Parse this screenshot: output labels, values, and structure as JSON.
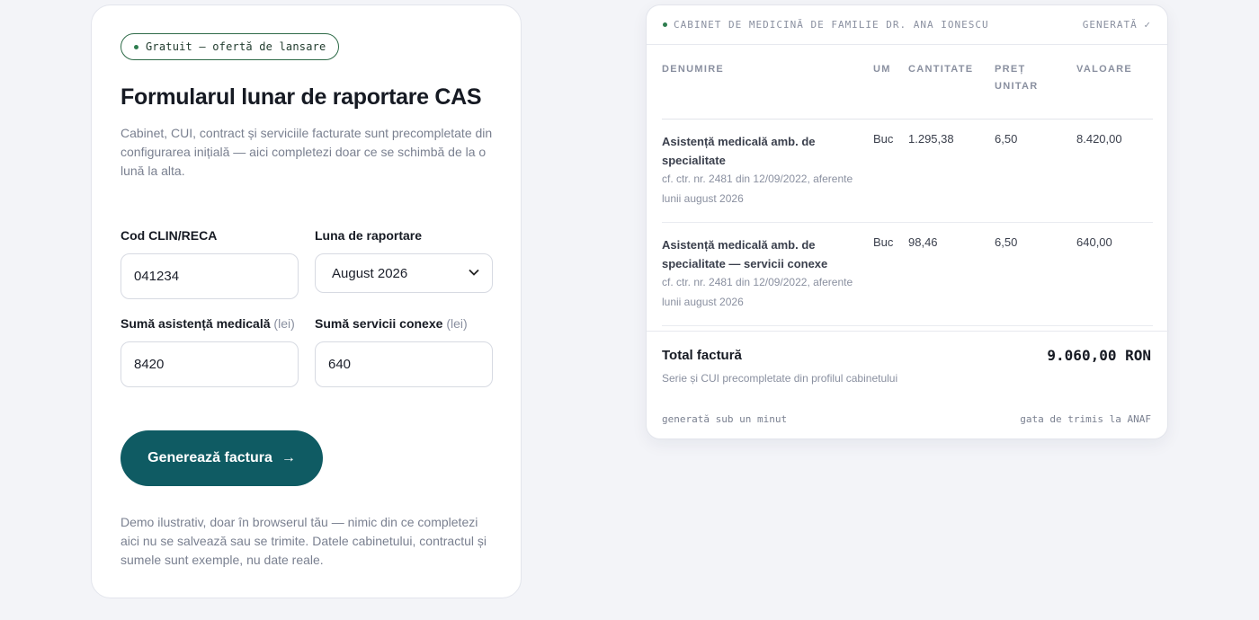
{
  "form": {
    "badge": "Gratuit — ofertă de lansare",
    "title": "Formularul lunar de raportare CAS",
    "description": "Cabinet, CUI, contract și serviciile facturate sunt precompletate din configurarea inițială — aici completezi doar ce se schimbă de la o lună la alta.",
    "fields": {
      "clin": {
        "label": "Cod CLIN/RECA",
        "value": "041234"
      },
      "month": {
        "label": "Luna de raportare",
        "value": "August 2026"
      },
      "medical": {
        "label": "Sumă asistență medicală",
        "unit": "(lei)",
        "value": "8420"
      },
      "conexe": {
        "label": "Sumă servicii conexe",
        "unit": "(lei)",
        "value": "640"
      }
    },
    "button_label": "Generează factura",
    "button_arrow": "→",
    "demo_note": "Demo ilustrativ, doar în browserul tău — nimic din ce completezi aici nu se salvează sau se trimite. Datele cabinetului, contractul și sumele sunt exemple, nu date reale."
  },
  "invoice": {
    "header_title": "CABINET DE MEDICINĂ DE FAMILIE DR. ANA IONESCU",
    "header_status": "GENERATĂ ✓",
    "columns": {
      "name": "DENUMIRE",
      "um": "UM",
      "qty": "CANTITATE",
      "price": "PREȚ UNITAR",
      "value": "VALOARE"
    },
    "rows": [
      {
        "name": "Asistență medicală amb. de specialitate",
        "note": "cf. ctr. nr. 2481 din 12/09/2022, aferente lunii august 2026",
        "um": "Buc",
        "qty": "1.295,38",
        "price": "6,50",
        "value": "8.420,00"
      },
      {
        "name": "Asistență medicală amb. de specialitate — servicii conexe",
        "note": "cf. ctr. nr. 2481 din 12/09/2022, aferente lunii august 2026",
        "um": "Buc",
        "qty": "98,46",
        "price": "6,50",
        "value": "640,00"
      }
    ],
    "total_label": "Total factură",
    "total_value": "9.060,00 RON",
    "total_sub": "Serie și CUI precompletate din profilul cabinetului",
    "footer_left": "generată sub un minut",
    "footer_right": "gata de trimis la ANAF"
  },
  "colors": {
    "accent": "#0f5b63",
    "badge_border": "#2e6b48",
    "status_dot": "#2e7d4f",
    "background": "#f3f4f8"
  }
}
